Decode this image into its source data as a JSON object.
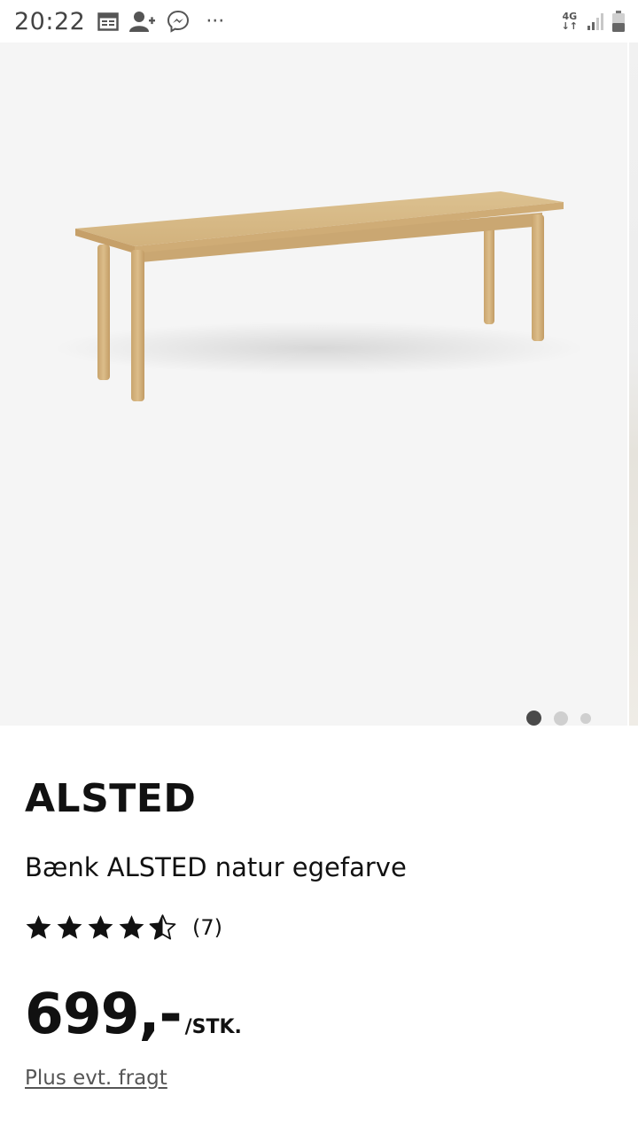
{
  "status_bar": {
    "time": "20:22",
    "overflow_icon": "···",
    "network_label_top": "4G",
    "network_label_bottom": "↓↑"
  },
  "gallery": {
    "image_alt": "Bench ALSTED",
    "page_count": 3,
    "active_index": 0
  },
  "product": {
    "name": "ALSTED",
    "description": "Bænk ALSTED natur egefarve",
    "rating": {
      "value": 4.5,
      "max": 5,
      "count_label": "(7)"
    },
    "price": "699,-",
    "unit": "/STK.",
    "shipping_note": "Plus evt. fragt"
  },
  "colors": {
    "hero_background": "#f5f5f5",
    "wood": "#d5b684",
    "text": "#111111",
    "dot_active": "#4a4a4a",
    "dot_inactive": "#cfcfcf"
  }
}
